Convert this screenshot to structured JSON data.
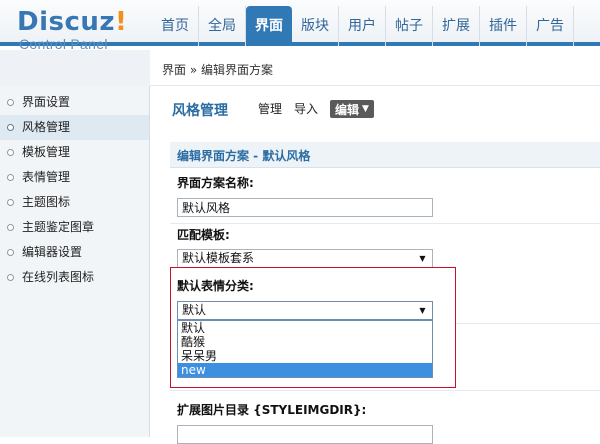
{
  "logo": {
    "main": "Discuz",
    "bang": "!",
    "sub": "Control Panel"
  },
  "topnav": [
    {
      "label": "首页",
      "active": false
    },
    {
      "label": "全局",
      "active": false
    },
    {
      "label": "界面",
      "active": true
    },
    {
      "label": "版块",
      "active": false
    },
    {
      "label": "用户",
      "active": false
    },
    {
      "label": "帖子",
      "active": false
    },
    {
      "label": "扩展",
      "active": false
    },
    {
      "label": "插件",
      "active": false
    },
    {
      "label": "广告",
      "active": false
    }
  ],
  "breadcrumb": "界面 » 编辑界面方案",
  "sidebar": {
    "items": [
      {
        "label": "界面设置",
        "active": false
      },
      {
        "label": "风格管理",
        "active": true
      },
      {
        "label": "模板管理",
        "active": false
      },
      {
        "label": "表情管理",
        "active": false
      },
      {
        "label": "主题图标",
        "active": false
      },
      {
        "label": "主题鉴定图章",
        "active": false
      },
      {
        "label": "编辑器设置",
        "active": false
      },
      {
        "label": "在线列表图标",
        "active": false
      }
    ]
  },
  "main": {
    "title": "风格管理",
    "subnav": {
      "manage": "管理",
      "import": "导入",
      "edit": "编辑"
    },
    "section_title": "编辑界面方案 - 默认风格",
    "fields": {
      "scheme_name_label": "界面方案名称:",
      "scheme_name_value": "默认风格",
      "template_label": "匹配模板:",
      "template_value": "默认模板套系",
      "emoji_label": "默认表情分类:",
      "emoji_value": "默认",
      "emoji_options": [
        "默认",
        "酷猴",
        "呆呆男",
        "new"
      ],
      "emoji_selected_index": 3,
      "imgdir_label": "扩展图片目录 {STYLEIMGDIR}:"
    }
  },
  "colors": {
    "accent": "#3079b5",
    "highlight_border": "#c8102e",
    "selected_option": "#3d8fe0"
  }
}
